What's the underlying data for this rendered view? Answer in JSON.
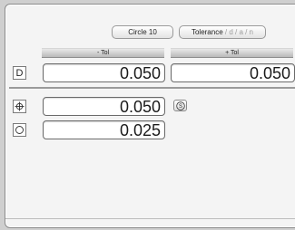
{
  "toolbar": {
    "circle_label": "Circle 10",
    "tolerance_label": "Tolerance",
    "tolerance_suffix": " / d / a / n"
  },
  "columns": {
    "minus_tol": "- Tol",
    "plus_tol": "+ Tol"
  },
  "rows": {
    "diameter": {
      "symbol": "D",
      "minus_value": "0.050",
      "plus_value": "0.050"
    },
    "position": {
      "symbol": "true-position-icon",
      "value": "0.050",
      "modifier": "S"
    },
    "circularity": {
      "symbol": "circularity-icon",
      "value": "0.025"
    }
  }
}
